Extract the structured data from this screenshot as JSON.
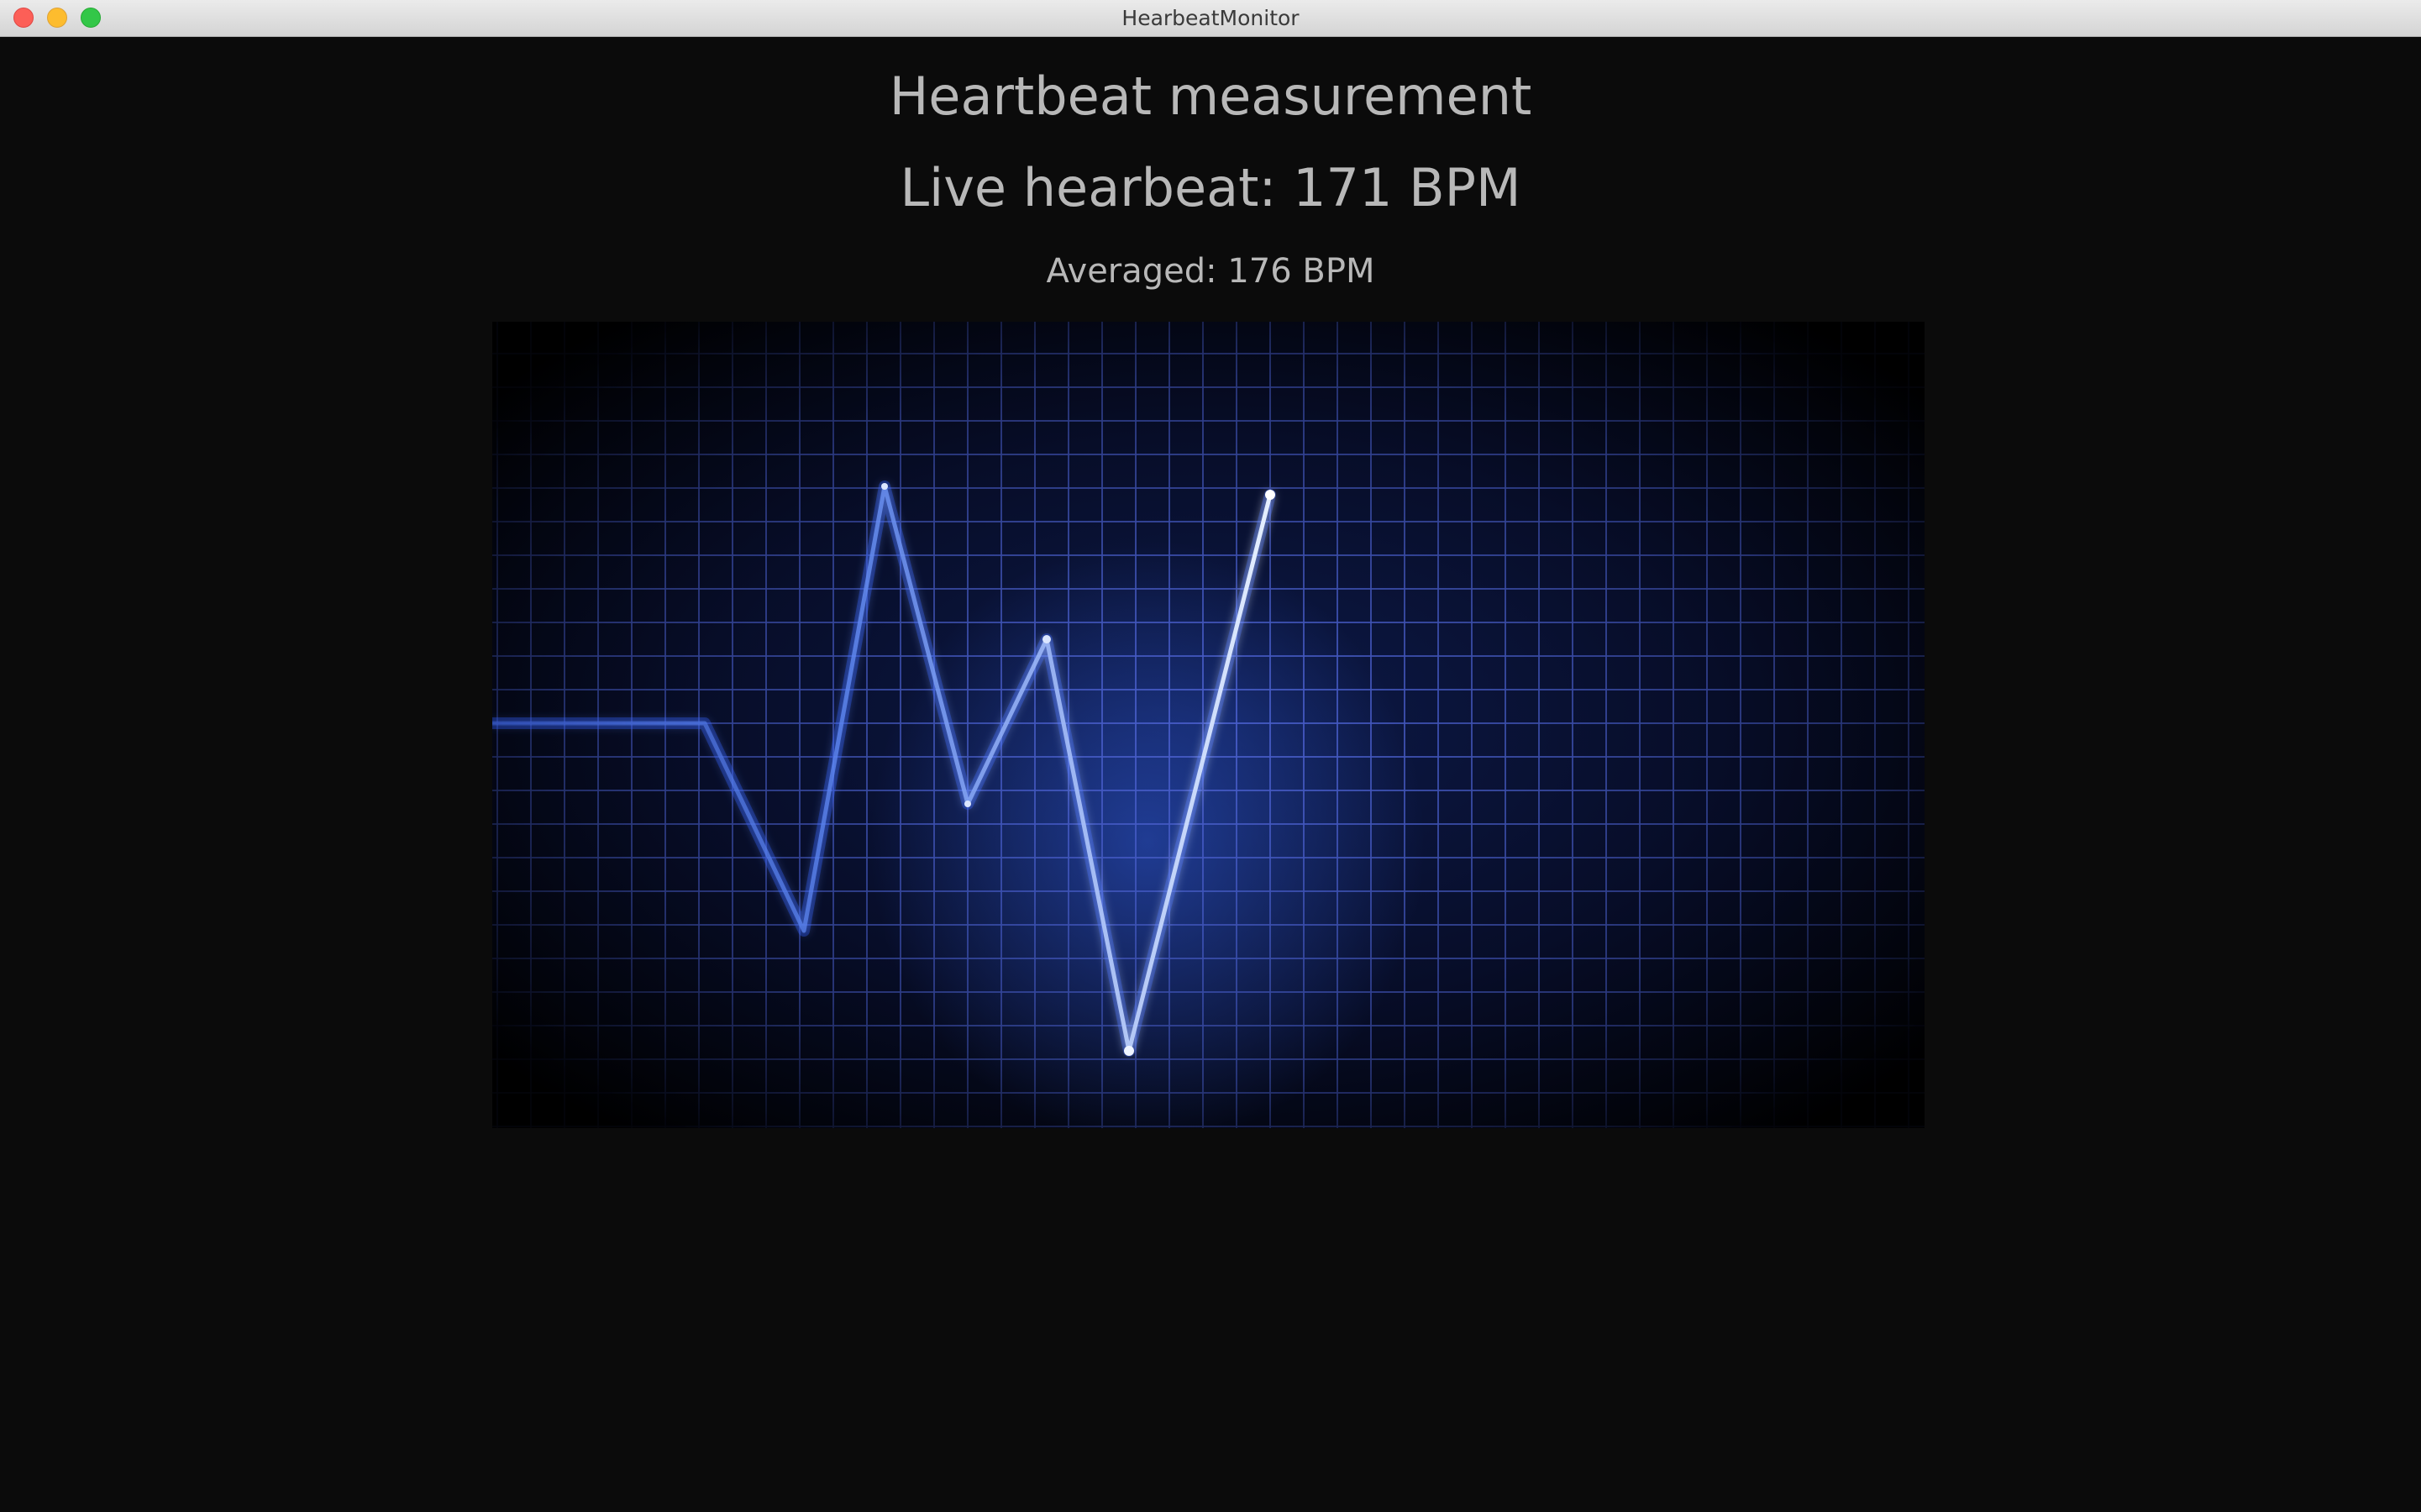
{
  "window": {
    "title": "HearbeatMonitor"
  },
  "main": {
    "title": "Heartbeat measurement",
    "live": "Live hearbeat: 171 BPM",
    "averaged": "Averaged: 176 BPM"
  },
  "colors": {
    "background": "#0b0b0b",
    "text": "#b8b8b8",
    "grid": "#4a5fcc",
    "trace": "#6f9bff",
    "trace_glow": "#2f5cff"
  }
}
